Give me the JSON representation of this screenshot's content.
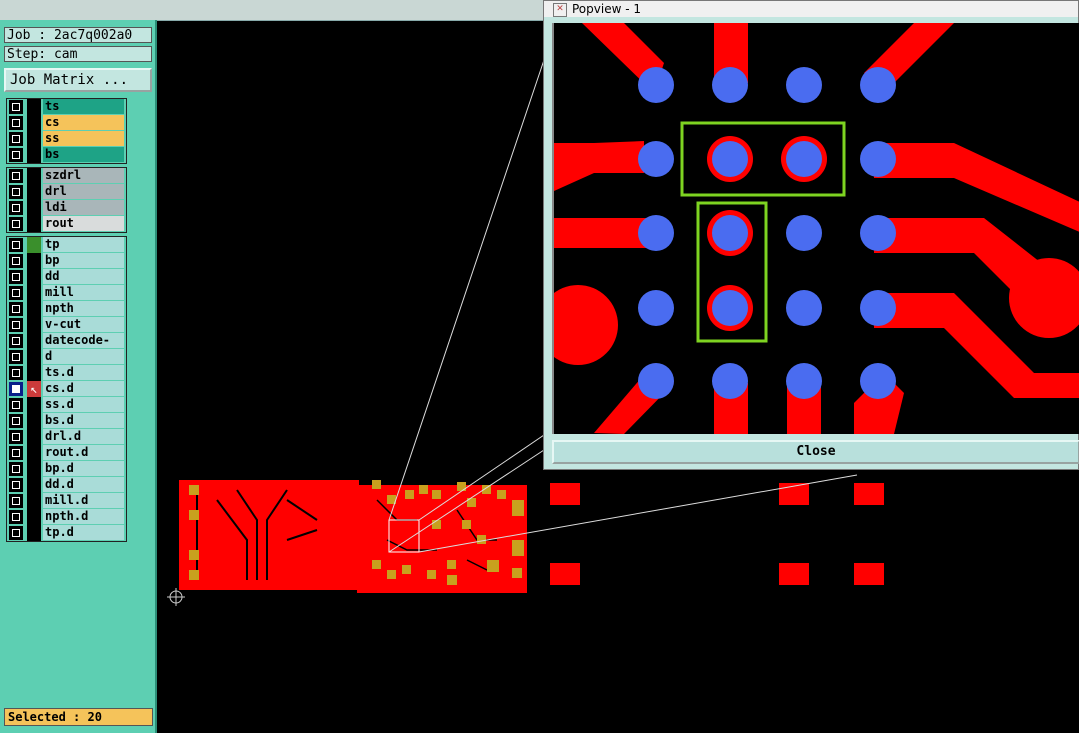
{
  "job": {
    "label": "Job : 2ac7q002a0"
  },
  "step": {
    "label": "Step: cam"
  },
  "job_matrix_button": "Job Matrix ...",
  "layer_groups": [
    {
      "layers": [
        {
          "name": "ts",
          "color": "teal"
        },
        {
          "name": "cs",
          "color": "orange"
        },
        {
          "name": "ss",
          "color": "orange"
        },
        {
          "name": "bs",
          "color": "teal"
        }
      ]
    },
    {
      "layers": [
        {
          "name": "szdrl",
          "color": "grey"
        },
        {
          "name": "drl",
          "color": "grey"
        },
        {
          "name": "ldi",
          "color": "grey"
        },
        {
          "name": "rout",
          "color": "ltgrey"
        }
      ]
    },
    {
      "layers": [
        {
          "name": "tp",
          "color": "cyan",
          "marker": "green"
        },
        {
          "name": "bp",
          "color": "cyan"
        },
        {
          "name": "dd",
          "color": "cyan"
        },
        {
          "name": "mill",
          "color": "cyan"
        },
        {
          "name": "npth",
          "color": "cyan"
        },
        {
          "name": "v-cut",
          "color": "cyan"
        },
        {
          "name": "datecode-ts",
          "color": "cyan"
        },
        {
          "name": "d",
          "color": "cyan"
        },
        {
          "name": "ts.d",
          "color": "cyan"
        },
        {
          "name": "cs.d",
          "color": "cyan",
          "selected": true,
          "marker": "arrow"
        },
        {
          "name": "ss.d",
          "color": "cyan"
        },
        {
          "name": "bs.d",
          "color": "cyan"
        },
        {
          "name": "drl.d",
          "color": "cyan"
        },
        {
          "name": "rout.d",
          "color": "cyan"
        },
        {
          "name": "bp.d",
          "color": "cyan"
        },
        {
          "name": "dd.d",
          "color": "cyan"
        },
        {
          "name": "mill.d",
          "color": "cyan"
        },
        {
          "name": "npth.d",
          "color": "cyan"
        },
        {
          "name": "tp.d",
          "color": "cyan"
        }
      ]
    }
  ],
  "status": {
    "selected": "Selected : 20"
  },
  "popview": {
    "title": "Popview - 1",
    "close_label": "Close"
  },
  "colors": {
    "copper": "#ff0000",
    "pad": "#c8a01e",
    "drill": "#4a6cf0",
    "highlight": "#7ed321"
  }
}
